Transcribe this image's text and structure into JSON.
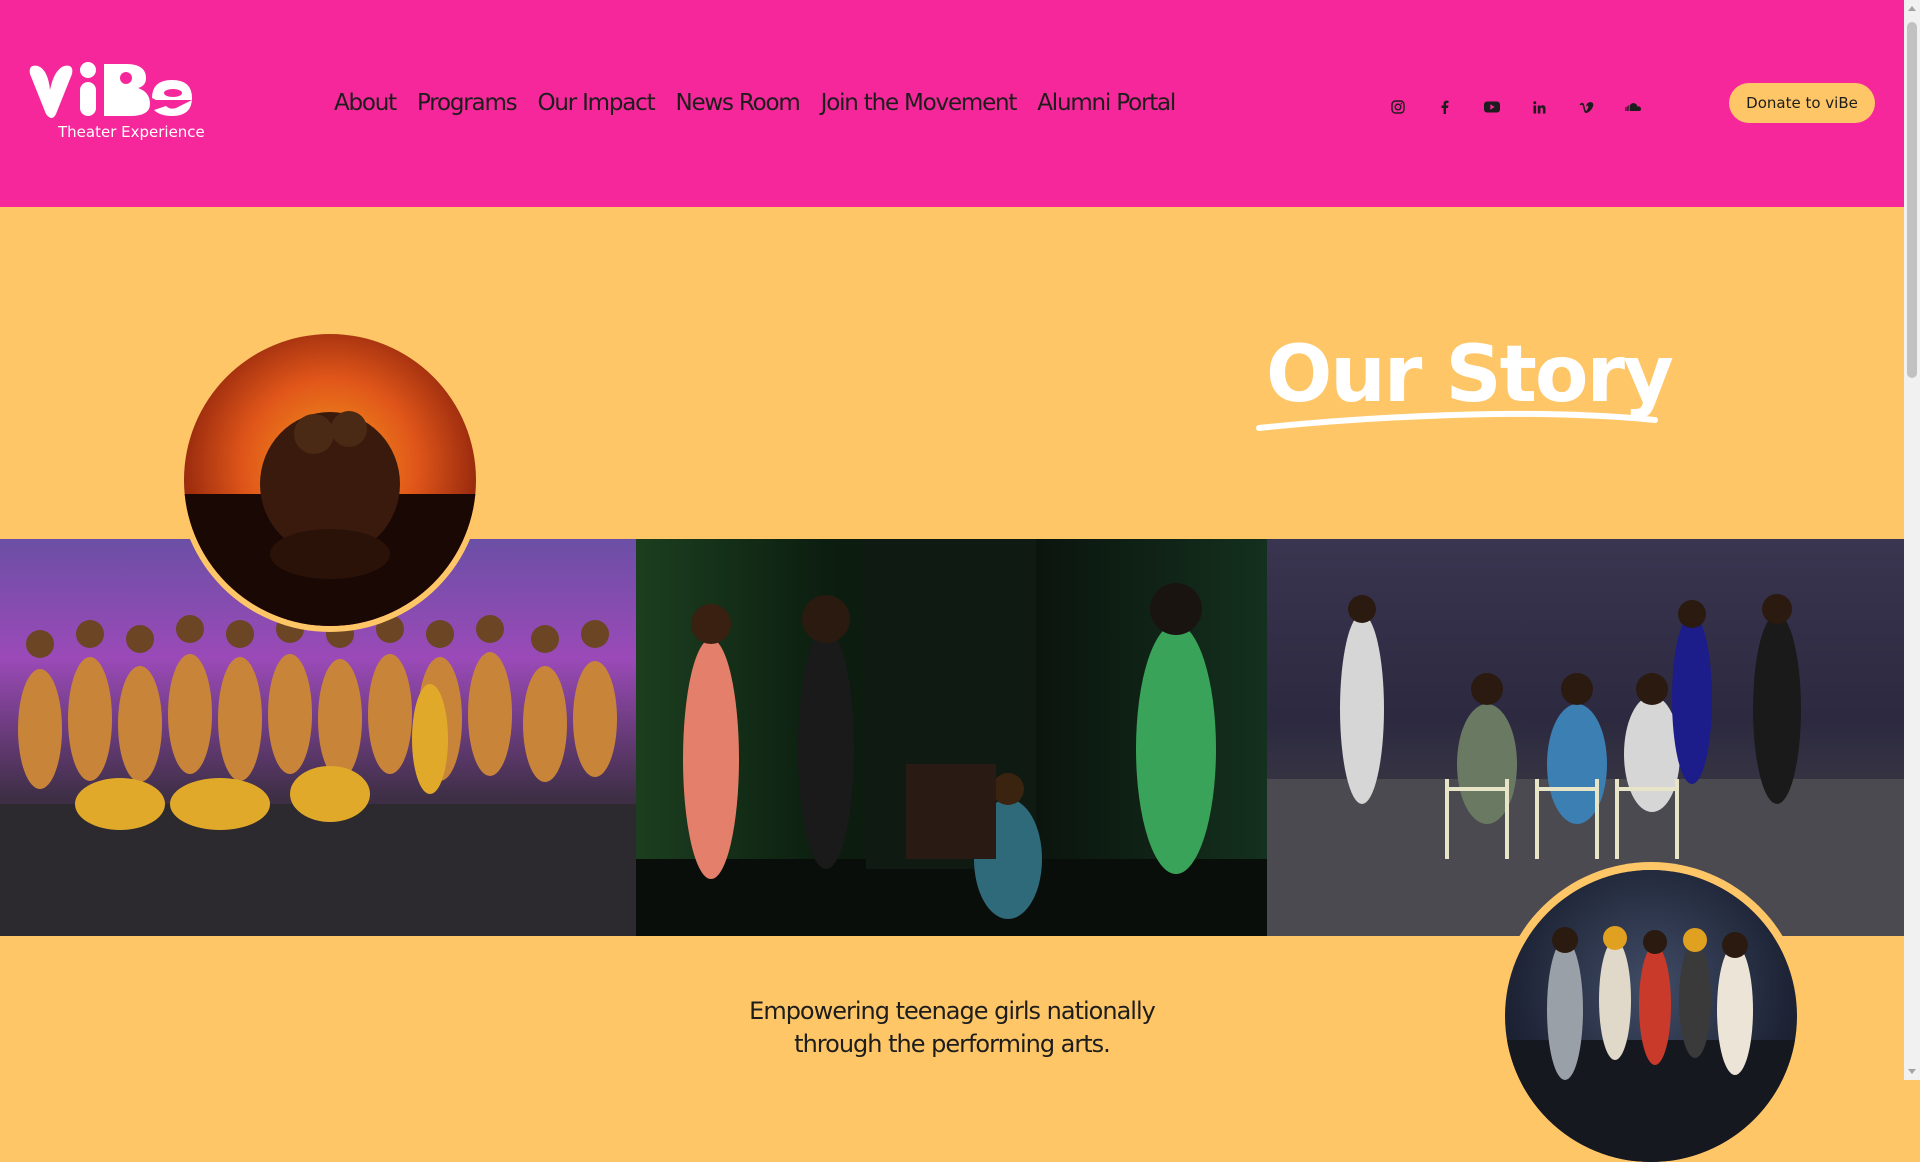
{
  "header": {
    "logo_text": "viBe",
    "logo_subtitle": "Theater Experience",
    "nav": [
      {
        "label": "About"
      },
      {
        "label": "Programs"
      },
      {
        "label": "Our Impact"
      },
      {
        "label": "News Room"
      },
      {
        "label": "Join the Movement"
      },
      {
        "label": "Alumni Portal"
      }
    ],
    "socials": [
      {
        "icon": "instagram-icon"
      },
      {
        "icon": "facebook-icon"
      },
      {
        "icon": "youtube-icon"
      },
      {
        "icon": "linkedin-icon"
      },
      {
        "icon": "vimeo-icon"
      },
      {
        "icon": "soundcloud-icon"
      }
    ],
    "donate_label": "Donate to viBe"
  },
  "hero": {
    "title": "Our Story",
    "tagline_line1": "Empowering teenage girls nationally",
    "tagline_line2": "through the performing arts."
  },
  "colors": {
    "header_bg": "#f5279a",
    "page_bg": "#fec667",
    "text": "#1d1d1d",
    "title": "#ffffff"
  }
}
